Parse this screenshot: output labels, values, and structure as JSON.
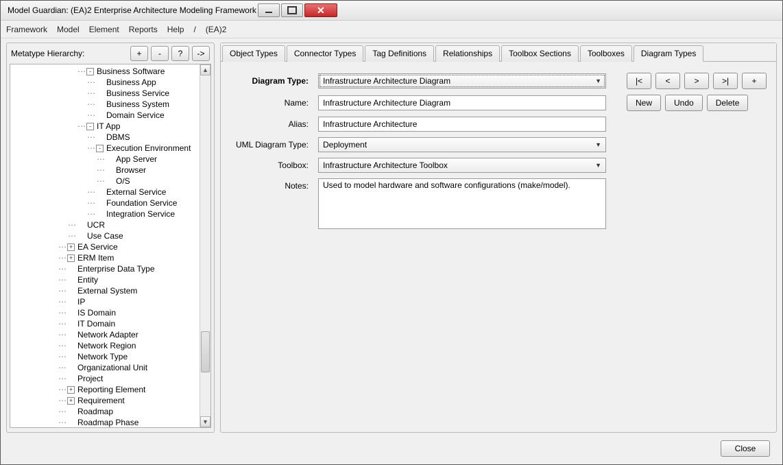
{
  "window": {
    "title": "Model Guardian: (EA)2 Enterprise Architecture Modeling Framework"
  },
  "menu": {
    "framework": "Framework",
    "model": "Model",
    "element": "Element",
    "reports": "Reports",
    "help": "Help",
    "sep": "/",
    "ea2": "(EA)2"
  },
  "left": {
    "header": "Metatype Hierarchy:",
    "btn_plus": "+",
    "btn_minus": "-",
    "btn_q": "?",
    "btn_go": "->",
    "tree": [
      {
        "indent": 7,
        "exp": "-",
        "label": "Business Software"
      },
      {
        "indent": 8,
        "exp": "",
        "label": "Business App"
      },
      {
        "indent": 8,
        "exp": "",
        "label": "Business Service"
      },
      {
        "indent": 8,
        "exp": "",
        "label": "Business System"
      },
      {
        "indent": 8,
        "exp": "",
        "label": "Domain Service"
      },
      {
        "indent": 7,
        "exp": "-",
        "label": "IT App"
      },
      {
        "indent": 8,
        "exp": "",
        "label": "DBMS"
      },
      {
        "indent": 8,
        "exp": "-",
        "label": "Execution Environment"
      },
      {
        "indent": 9,
        "exp": "",
        "label": "App Server"
      },
      {
        "indent": 9,
        "exp": "",
        "label": "Browser"
      },
      {
        "indent": 9,
        "exp": "",
        "label": "O/S"
      },
      {
        "indent": 8,
        "exp": "",
        "label": "External Service"
      },
      {
        "indent": 8,
        "exp": "",
        "label": "Foundation Service"
      },
      {
        "indent": 8,
        "exp": "",
        "label": "Integration Service"
      },
      {
        "indent": 6,
        "exp": "",
        "label": "UCR"
      },
      {
        "indent": 6,
        "exp": "",
        "label": "Use Case"
      },
      {
        "indent": 5,
        "exp": "+",
        "label": "EA Service"
      },
      {
        "indent": 5,
        "exp": "+",
        "label": "ERM Item"
      },
      {
        "indent": 5,
        "exp": "",
        "label": "Enterprise Data Type"
      },
      {
        "indent": 5,
        "exp": "",
        "label": "Entity"
      },
      {
        "indent": 5,
        "exp": "",
        "label": "External System"
      },
      {
        "indent": 5,
        "exp": "",
        "label": "IP"
      },
      {
        "indent": 5,
        "exp": "",
        "label": "IS Domain"
      },
      {
        "indent": 5,
        "exp": "",
        "label": "IT Domain"
      },
      {
        "indent": 5,
        "exp": "",
        "label": "Network Adapter"
      },
      {
        "indent": 5,
        "exp": "",
        "label": "Network Region"
      },
      {
        "indent": 5,
        "exp": "",
        "label": "Network Type"
      },
      {
        "indent": 5,
        "exp": "",
        "label": "Organizational Unit"
      },
      {
        "indent": 5,
        "exp": "",
        "label": "Project"
      },
      {
        "indent": 5,
        "exp": "+",
        "label": "Reporting Element"
      },
      {
        "indent": 5,
        "exp": "+",
        "label": "Requirement"
      },
      {
        "indent": 5,
        "exp": "",
        "label": "Roadmap"
      },
      {
        "indent": 5,
        "exp": "",
        "label": "Roadmap Phase"
      }
    ]
  },
  "tabs": {
    "object_types": "Object Types",
    "connector_types": "Connector Types",
    "tag_definitions": "Tag Definitions",
    "relationships": "Relationships",
    "toolbox_sections": "Toolbox Sections",
    "toolboxes": "Toolboxes",
    "diagram_types": "Diagram Types"
  },
  "form": {
    "labels": {
      "diagram_type": "Diagram Type:",
      "name": "Name:",
      "alias": "Alias:",
      "uml": "UML Diagram Type:",
      "toolbox": "Toolbox:",
      "notes": "Notes:"
    },
    "values": {
      "diagram_type": "Infrastructure Architecture Diagram",
      "name": "Infrastructure Architecture Diagram",
      "alias": "Infrastructure Architecture",
      "uml": "Deployment",
      "toolbox": "Infrastructure Architecture Toolbox",
      "notes": "Used to model hardware and software configurations (make/model)."
    },
    "nav": {
      "first": "|<",
      "prev": "<",
      "next": ">",
      "last": ">|",
      "add": "+"
    },
    "crud": {
      "new": "New",
      "undo": "Undo",
      "delete": "Delete"
    }
  },
  "footer": {
    "close": "Close"
  }
}
